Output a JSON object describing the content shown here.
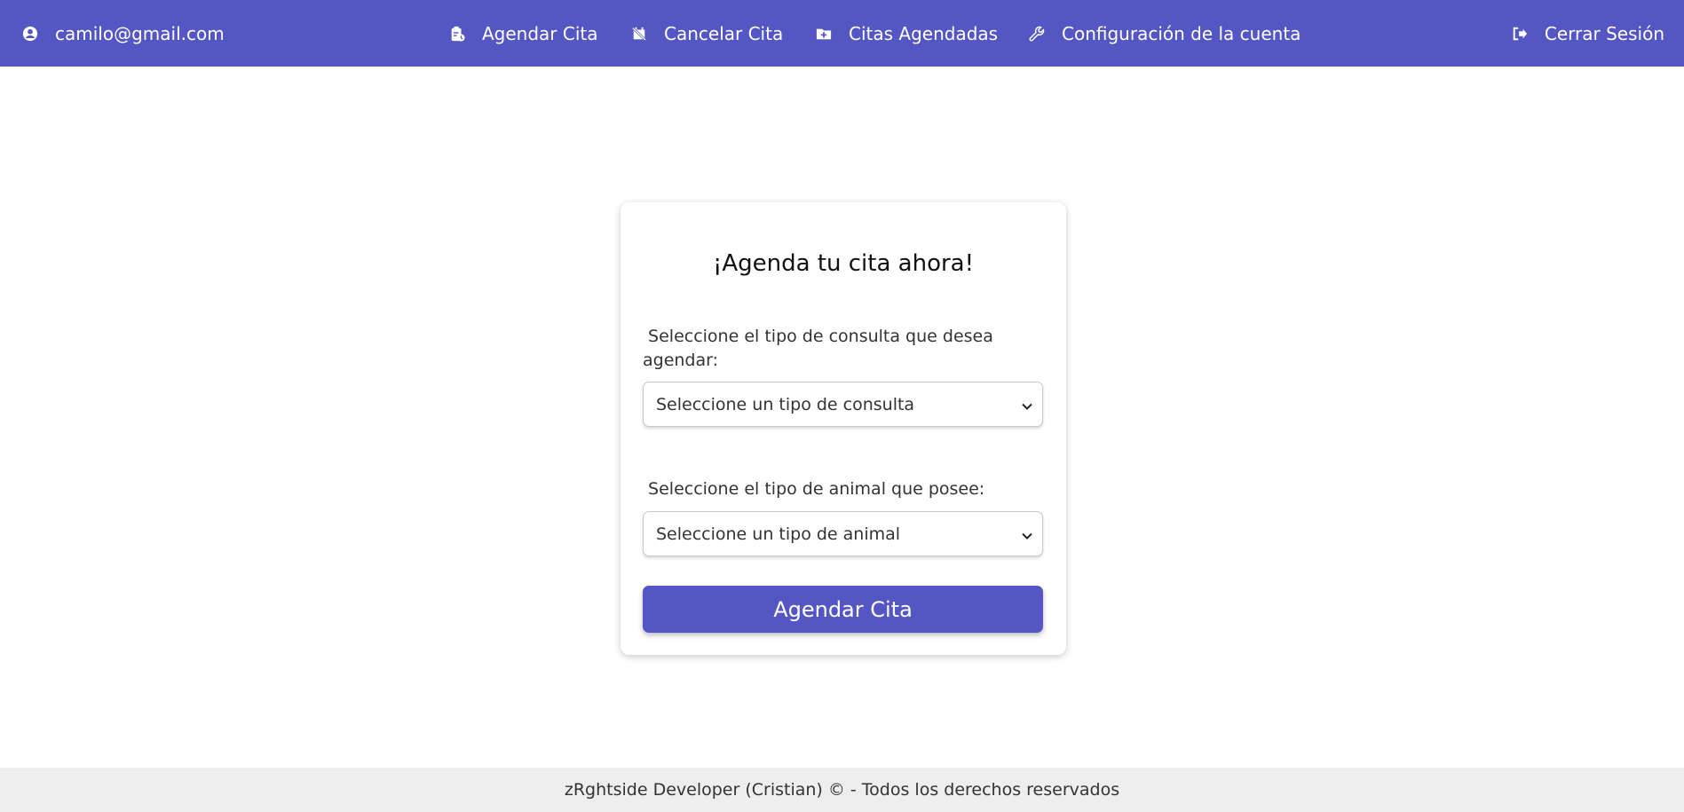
{
  "navbar": {
    "user_email": "camilo@gmail.com",
    "items": [
      {
        "label": "Agendar Cita",
        "icon": "clipboard-clock-icon"
      },
      {
        "label": "Cancelar Cita",
        "icon": "calendar-slash-icon"
      },
      {
        "label": "Citas Agendadas",
        "icon": "folder-plus-icon"
      },
      {
        "label": "Configuración de la cuenta",
        "icon": "wrench-icon"
      }
    ],
    "logout_label": "Cerrar Sesión",
    "accent_color": "#5456c3"
  },
  "form": {
    "title": "¡Agenda tu cita ahora!",
    "consulta_label": "Seleccione el tipo de consulta que desea agendar:",
    "consulta_selected": "Seleccione un tipo de consulta",
    "animal_label": "Seleccione el tipo de animal que posee:",
    "animal_selected": "Seleccione un tipo de animal",
    "submit_label": "Agendar Cita"
  },
  "footer": {
    "text": "zRghtside Developer (Cristian) © - Todos los derechos reservados"
  }
}
